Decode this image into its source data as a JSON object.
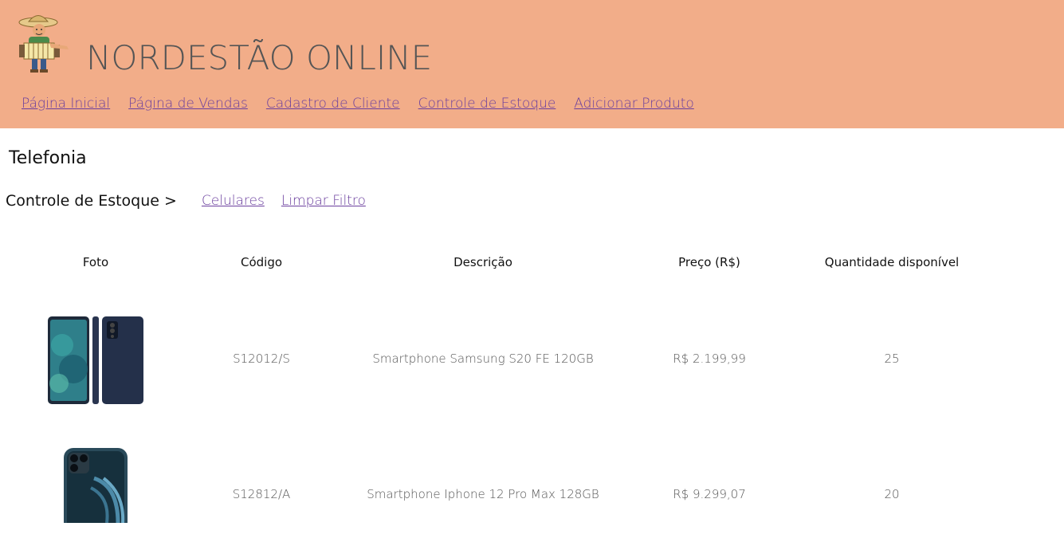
{
  "header": {
    "title": "NORDESTÃO ONLINE",
    "background": "#f2ad89",
    "logo_icon": "accordion-player-logo"
  },
  "nav": {
    "items": [
      {
        "label": "Página Inicial"
      },
      {
        "label": "Página de Vendas"
      },
      {
        "label": "Cadastro de Cliente"
      },
      {
        "label": "Controle de Estoque"
      },
      {
        "label": "Adicionar Produto"
      }
    ],
    "link_color": "#6b3f9e"
  },
  "page": {
    "category": "Telefonia",
    "breadcrumb_label": "Controle de Estoque >",
    "filters": [
      {
        "label": "Celulares"
      },
      {
        "label": "Limpar Filtro"
      }
    ]
  },
  "table": {
    "headers": {
      "photo": "Foto",
      "code": "Código",
      "description": "Descrição",
      "price": "Preço (R$)",
      "quantity": "Quantidade disponível"
    },
    "rows": [
      {
        "photo_icon": "samsung-phone-image",
        "code": "S12012/S",
        "description": "Smartphone Samsung S20 FE 120GB",
        "price": "R$ 2.199,99",
        "quantity": "25"
      },
      {
        "photo_icon": "iphone-image",
        "code": "S12812/A",
        "description": "Smartphone Iphone 12 Pro Max 128GB",
        "price": "R$ 9.299,07",
        "quantity": "20"
      }
    ]
  }
}
